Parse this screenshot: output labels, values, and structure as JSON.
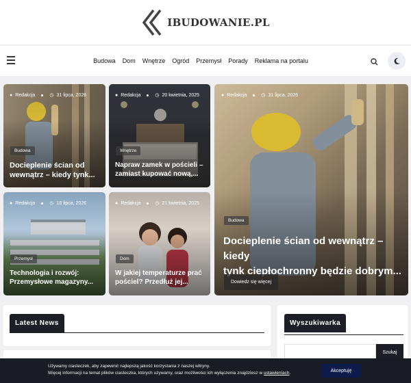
{
  "site": {
    "logo_text": "IBUDOWANIE.PL"
  },
  "nav": {
    "links": [
      "Budowa",
      "Dom",
      "Wnętrze",
      "Ogród",
      "Przemysł",
      "Porady",
      "Reklama na portalu"
    ]
  },
  "posts": [
    {
      "author": "Redakcja",
      "date": "31 lipca, 2026",
      "category": "Budowa",
      "title_line1": "Docieplenie ścian od",
      "title_line2": "wewnątrz – kiedy tynk..."
    },
    {
      "author": "Redakcja",
      "date": "20 kwietnia, 2025",
      "category": "Wnętrze",
      "title_line1": "Napraw zamek w pościeli –",
      "title_line2": "zamiast kupować nową,..."
    },
    {
      "author": "Redakcja",
      "date": "16 lipca, 2026",
      "category": "Przemysł",
      "title_line1": "Technologia i rozwój:",
      "title_line2": "Przemysłowe magazyny..."
    },
    {
      "author": "Redakcja",
      "date": "21 kwietnia, 2025",
      "category": "Dom",
      "title_line1": "W jakiej temperaturze prać",
      "title_line2": "pościel? Przedłuż jej..."
    }
  ],
  "featured": {
    "author": "Redakcja",
    "date": "31 lipca, 2026",
    "category": "Budowa",
    "title_line1": "Docieplenie ścian od wewnątrz – kiedy",
    "title_line2": "tynk ciepłochronny będzie dobrym...",
    "read_more": "Dowiedz się więcej"
  },
  "widgets": {
    "latest_news": "Latest News",
    "search_title": "Wyszukiwarka",
    "search_button": "Szukaj"
  },
  "cookie": {
    "line1": "Używamy ciasteczek, aby zapewnić najlepszą jakość korzystania z naszej witryny.",
    "line2_pre": "Więcej informacji na temat plików ciasteczka, których używamy, oraz możliwości ich wyłączenia znajdziesz w ",
    "line2_link": "ustawieniach",
    "line2_post": ".",
    "accept": "Akceptuję"
  },
  "colors": {
    "dark": "#1e1f26",
    "accept_button": "#0b1b4a"
  }
}
